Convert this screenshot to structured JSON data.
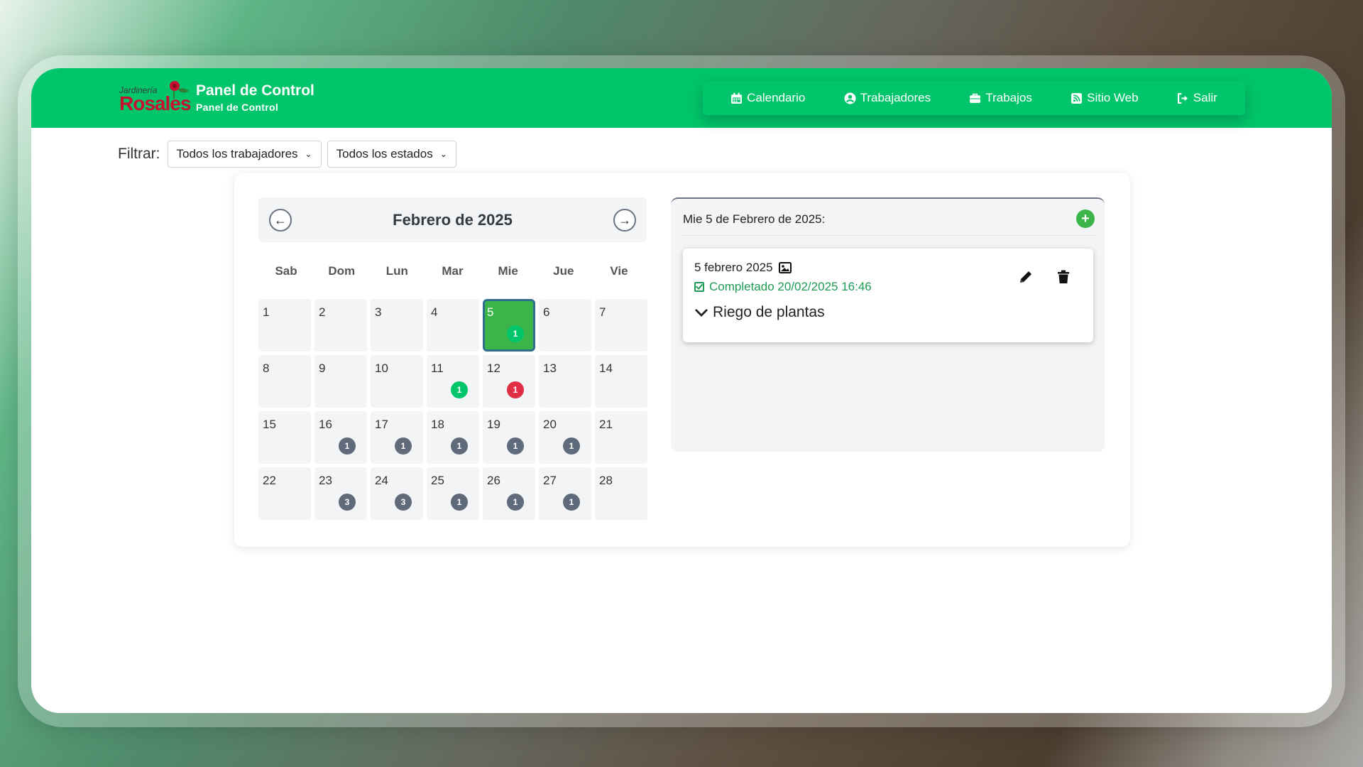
{
  "brand": {
    "logo_small": "Jardinería",
    "logo_big": "Rosales",
    "title": "Panel de Control",
    "subtitle": "Panel de Control"
  },
  "nav": [
    {
      "label": "Calendario",
      "icon": "calendar-icon"
    },
    {
      "label": "Trabajadores",
      "icon": "user-circle-icon"
    },
    {
      "label": "Trabajos",
      "icon": "briefcase-icon"
    },
    {
      "label": "Sitio Web",
      "icon": "rss-icon"
    },
    {
      "label": "Salir",
      "icon": "sign-out-icon"
    }
  ],
  "filters": {
    "label": "Filtrar:",
    "workers": "Todos los trabajadores",
    "states": "Todos los estados"
  },
  "calendar": {
    "title": "Febrero de 2025",
    "weekdays": [
      "Sab",
      "Dom",
      "Lun",
      "Mar",
      "Mie",
      "Jue",
      "Vie"
    ],
    "days": [
      {
        "n": "1"
      },
      {
        "n": "2"
      },
      {
        "n": "3"
      },
      {
        "n": "4"
      },
      {
        "n": "5",
        "selected": true,
        "badge": "1",
        "badge_color": "green"
      },
      {
        "n": "6"
      },
      {
        "n": "7"
      },
      {
        "n": "8"
      },
      {
        "n": "9"
      },
      {
        "n": "10"
      },
      {
        "n": "11",
        "badge": "1",
        "badge_color": "green"
      },
      {
        "n": "12",
        "badge": "1",
        "badge_color": "red"
      },
      {
        "n": "13"
      },
      {
        "n": "14"
      },
      {
        "n": "15"
      },
      {
        "n": "16",
        "badge": "1",
        "badge_color": "gray"
      },
      {
        "n": "17",
        "badge": "1",
        "badge_color": "gray"
      },
      {
        "n": "18",
        "badge": "1",
        "badge_color": "gray"
      },
      {
        "n": "19",
        "badge": "1",
        "badge_color": "gray"
      },
      {
        "n": "20",
        "badge": "1",
        "badge_color": "gray"
      },
      {
        "n": "21"
      },
      {
        "n": "22"
      },
      {
        "n": "23",
        "badge": "3",
        "badge_color": "gray"
      },
      {
        "n": "24",
        "badge": "3",
        "badge_color": "gray"
      },
      {
        "n": "25",
        "badge": "1",
        "badge_color": "gray"
      },
      {
        "n": "26",
        "badge": "1",
        "badge_color": "gray"
      },
      {
        "n": "27",
        "badge": "1",
        "badge_color": "gray"
      },
      {
        "n": "28"
      }
    ]
  },
  "detail": {
    "title": "Mie 5 de Febrero de 2025:",
    "task": {
      "date": "5 febrero 2025",
      "status": "Completado 20/02/2025 16:46",
      "name": "Riego de plantas"
    }
  },
  "colors": {
    "primary": "#00c56a",
    "selected_day": "#3bb54a",
    "badge_red": "#e02f44",
    "badge_gray": "#5f6b7a",
    "status_green": "#1f9b55"
  },
  "fab_label": "+"
}
